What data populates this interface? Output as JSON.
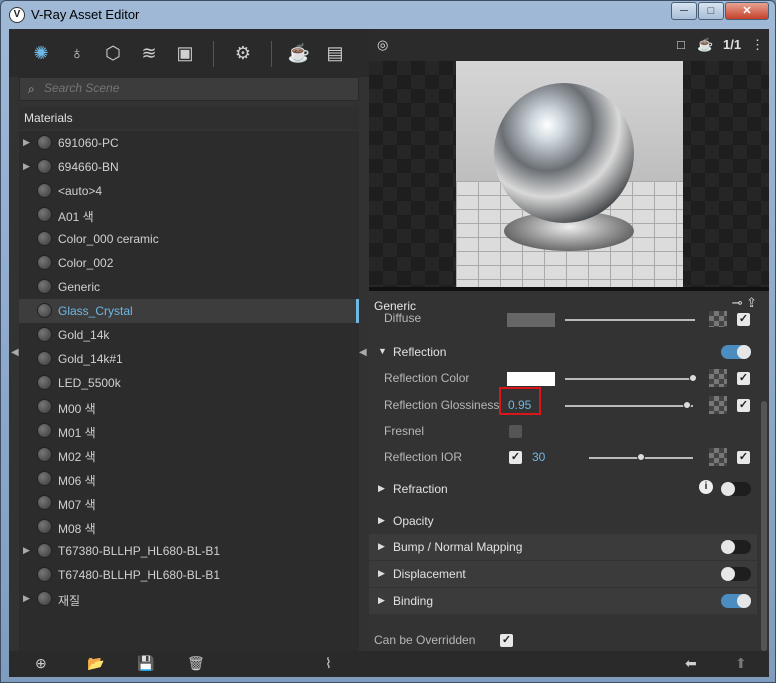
{
  "window": {
    "title": "V-Ray Asset Editor",
    "buttons": [
      "─",
      "□",
      "✕"
    ]
  },
  "categories": [
    {
      "name": "materials-icon",
      "glyph": "✺"
    },
    {
      "name": "lights-icon",
      "glyph": "♁"
    },
    {
      "name": "geometry-icon",
      "glyph": "⬡"
    },
    {
      "name": "layers-icon",
      "glyph": "≋"
    },
    {
      "name": "textures-icon",
      "glyph": "▣"
    },
    {
      "name": "settings-icon",
      "glyph": "⚙"
    },
    {
      "name": "render-teapot-icon",
      "glyph": "☕"
    },
    {
      "name": "frame-buffer-icon",
      "glyph": "▤"
    }
  ],
  "search": {
    "placeholder": "Search Scene"
  },
  "materials": {
    "header": "Materials",
    "items": [
      {
        "label": "691060-PC",
        "expandable": true
      },
      {
        "label": "694660-BN",
        "expandable": true
      },
      {
        "label": "<auto>4",
        "expandable": false
      },
      {
        "label": "A01 색",
        "expandable": false
      },
      {
        "label": "Color_000 ceramic",
        "expandable": false
      },
      {
        "label": "Color_002",
        "expandable": false
      },
      {
        "label": "Generic",
        "expandable": false
      },
      {
        "label": "Glass_Crystal",
        "expandable": false,
        "selected": true
      },
      {
        "label": "Gold_14k",
        "expandable": false
      },
      {
        "label": "Gold_14k#1",
        "expandable": false
      },
      {
        "label": "LED_5500k",
        "expandable": false
      },
      {
        "label": "M00 색",
        "expandable": false
      },
      {
        "label": "M01 색",
        "expandable": false
      },
      {
        "label": "M02 색",
        "expandable": false
      },
      {
        "label": "M06 색",
        "expandable": false
      },
      {
        "label": "M07 색",
        "expandable": false
      },
      {
        "label": "M08 색",
        "expandable": false
      },
      {
        "label": "T67380-BLLHP_HL680-BL-B1",
        "expandable": true
      },
      {
        "label": "T67480-BLLHP_HL680-BL-B1",
        "expandable": false
      },
      {
        "label": "재질",
        "expandable": true
      }
    ]
  },
  "preview": {
    "count_label": "1/1"
  },
  "properties": {
    "title": "Generic",
    "diffuse_label": "Diffuse",
    "reflection": {
      "label": "Reflection",
      "enabled": true,
      "color_label": "Reflection Color",
      "color_value": "#ffffff",
      "color_slider": 1.0,
      "glossiness_label": "Reflection Glossiness",
      "glossiness_value": "0.95",
      "glossiness_slider": 0.95,
      "fresnel_label": "Fresnel",
      "fresnel_checked": false,
      "ior_label": "Reflection IOR",
      "ior_checked": true,
      "ior_value": "30",
      "ior_slider": 0.5
    },
    "sections": [
      {
        "label": "Refraction",
        "toggle": "off",
        "info": true
      },
      {
        "label": "Opacity",
        "toggle": null
      },
      {
        "label": "Bump / Normal Mapping",
        "toggle": "off"
      },
      {
        "label": "Displacement",
        "toggle": "off"
      },
      {
        "label": "Binding",
        "toggle": "on"
      }
    ],
    "overridden_label": "Can be Overridden",
    "overridden_checked": true
  },
  "colors": {
    "accent": "#6fb7e4",
    "highlight": "#d9161a",
    "toggle_on": "#4c8dc1"
  }
}
